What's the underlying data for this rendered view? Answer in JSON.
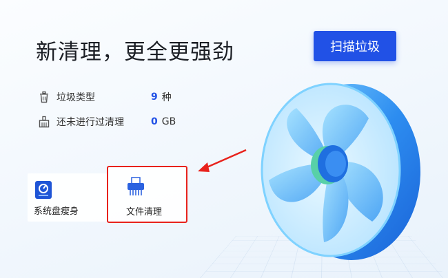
{
  "headline": "新清理，更全更强劲",
  "scan_button": "扫描垃圾",
  "stats": [
    {
      "label": "垃圾类型",
      "value": "9",
      "unit": "种",
      "icon": "trash-icon"
    },
    {
      "label": "还未进行过清理",
      "value": "0",
      "unit": "GB",
      "icon": "broom-icon"
    }
  ],
  "tiles": [
    {
      "label": "系统盘瘦身",
      "icon": "disk-slim-icon"
    },
    {
      "label": "文件清理",
      "icon": "file-shredder-icon"
    }
  ],
  "colors": {
    "accent": "#2151e6",
    "highlight": "#e8221c"
  }
}
